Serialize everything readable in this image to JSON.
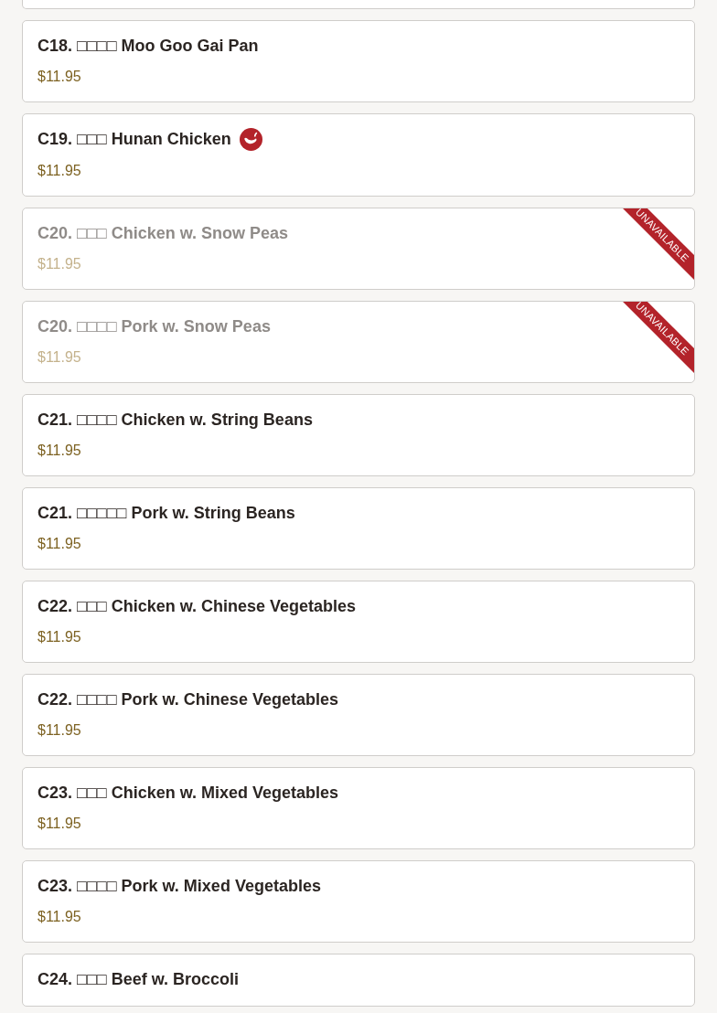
{
  "items": [
    {
      "title": "C18. □□□□ Moo Goo Gai Pan",
      "price": "$11.95",
      "spicy": false,
      "available": true
    },
    {
      "title": "C19. □□□ Hunan Chicken",
      "price": "$11.95",
      "spicy": true,
      "available": true
    },
    {
      "title": "C20. □□□ Chicken w. Snow Peas",
      "price": "$11.95",
      "spicy": false,
      "available": false,
      "badge": "UNAVAILABLE"
    },
    {
      "title": "C20. □□□□ Pork w. Snow Peas",
      "price": "$11.95",
      "spicy": false,
      "available": false,
      "badge": "UNAVAILABLE"
    },
    {
      "title": "C21. □□□□ Chicken w. String Beans",
      "price": "$11.95",
      "spicy": false,
      "available": true
    },
    {
      "title": "C21. □□□□□ Pork w. String Beans",
      "price": "$11.95",
      "spicy": false,
      "available": true
    },
    {
      "title": "C22. □□□ Chicken w. Chinese Vegetables",
      "price": "$11.95",
      "spicy": false,
      "available": true
    },
    {
      "title": "C22. □□□□ Pork w. Chinese Vegetables",
      "price": "$11.95",
      "spicy": false,
      "available": true
    },
    {
      "title": "C23. □□□ Chicken w. Mixed Vegetables",
      "price": "$11.95",
      "spicy": false,
      "available": true
    },
    {
      "title": "C23. □□□□ Pork w. Mixed Vegetables",
      "price": "$11.95",
      "spicy": false,
      "available": true
    },
    {
      "title": "C24. □□□ Beef w. Broccoli",
      "spicy": false,
      "available": true
    }
  ]
}
